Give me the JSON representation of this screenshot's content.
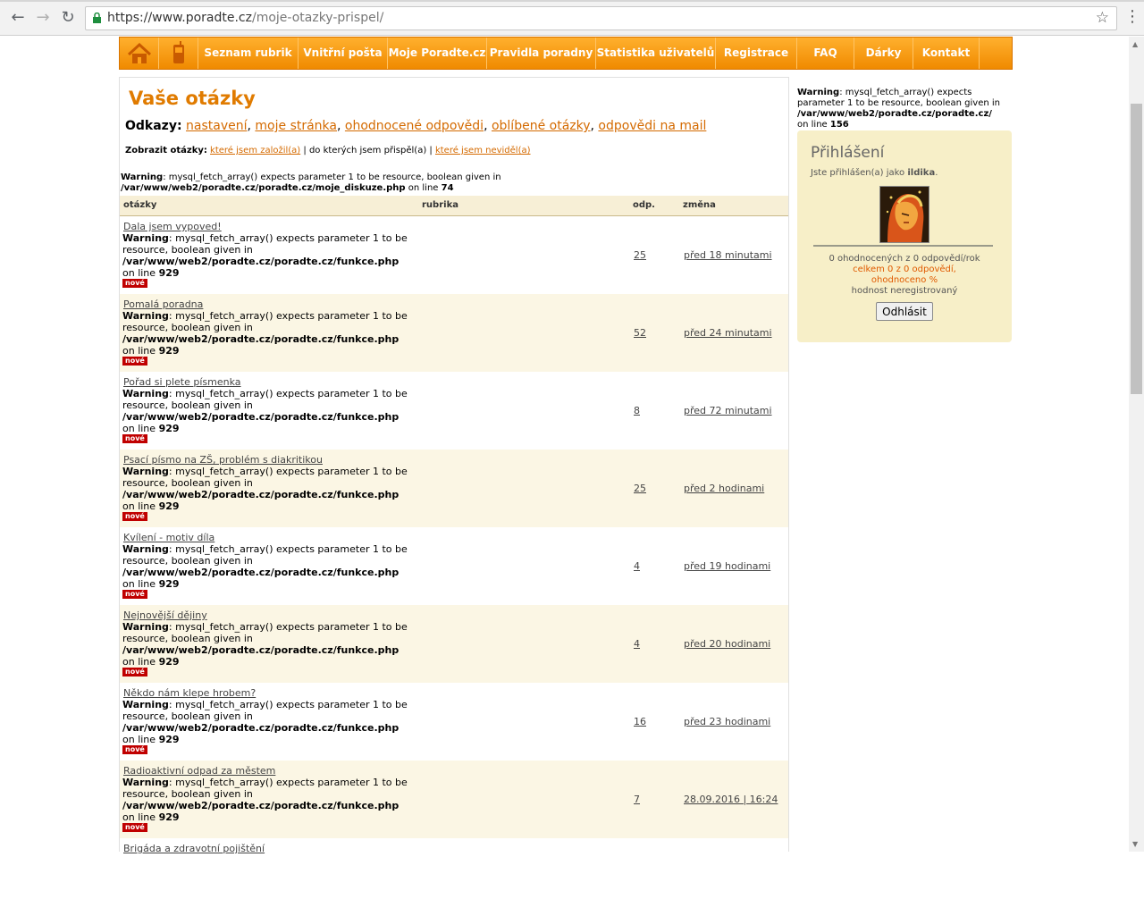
{
  "browser": {
    "url_base": "https://www.poradte.cz",
    "url_path": "/moje-otazky-prispel/"
  },
  "nav": {
    "items": [
      "Seznam rubrik",
      "Vnitřní pošta",
      "Moje Poradte.cz",
      "Pravidla poradny",
      "Statistika uživatelů",
      "Registrace",
      "FAQ",
      "Dárky",
      "Kontakt"
    ]
  },
  "main": {
    "title": "Vaše otázky",
    "links_label": "Odkazy:",
    "links": [
      "nastavení",
      "moje stránka",
      "ohodnocené odpovědi",
      "oblíbené otázky",
      "odpovědi na mail"
    ],
    "filter_label": "Zobrazit otázky:",
    "filter_created": "které jsem založil(a)",
    "filter_current": "do kterých jsem přispěl(a)",
    "filter_unseen": "které jsem neviděl(a)",
    "warning_label": "Warning",
    "warning_text": ": mysql_fetch_array() expects parameter 1 to be resource, boolean given in",
    "warning_path": "/var/www/web2/poradte.cz/poradte.cz/moje_diskuze.php",
    "warning_line_text": "on line",
    "warning_line": "74",
    "table_headers": [
      "otázky",
      "rubrika",
      "odp.",
      "změna"
    ],
    "row_warning_text": ": mysql_fetch_array() expects parameter 1 to be resource, boolean given in",
    "row_warning_path": "/var/www/web2/poradte.cz/poradte.cz/funkce.php",
    "row_warning_line": "929",
    "badge": "nové",
    "rows": [
      {
        "question": "Dala jsem vypoved!",
        "count": "25",
        "change": "před 18 minutami"
      },
      {
        "question": "Pomalá poradna",
        "count": "52",
        "change": "před 24 minutami"
      },
      {
        "question": "Pořad si plete písmenka",
        "count": "8",
        "change": "před 72 minutami"
      },
      {
        "question": "Psací písmo na ZŠ, problém s diakritikou",
        "count": "25",
        "change": "před 2 hodinami"
      },
      {
        "question": "Kvílení - motiv díla",
        "count": "4",
        "change": "před 19 hodinami"
      },
      {
        "question": "Nejnovější dějiny",
        "count": "4",
        "change": "před 20 hodinami"
      },
      {
        "question": "Někdo nám klepe hrobem?",
        "count": "16",
        "change": "před 23 hodinami"
      },
      {
        "question": "Radioaktivní odpad za městem",
        "count": "7",
        "change": "28.09.2016 | 16:24"
      },
      {
        "question": "Brigáda a zdravotní pojištění",
        "count": "",
        "change": ""
      }
    ]
  },
  "sidebar": {
    "warning_path": "/var/www/web2/poradte.cz/poradte.cz/",
    "warning_line": "156",
    "login_title": "Přihlášení",
    "logged_as": "Jste přihlášen(a) jako",
    "username": "ildika",
    "stat1": "0 ohodnocených z 0 odpovědí/rok",
    "stat2": "celkem 0 z 0 odpovědí,",
    "stat3": "ohodnoceno %",
    "stat4": "hodnost neregistrovaný",
    "logout_label": "Odhlásit"
  },
  "colors": {
    "accent": "#e07b00",
    "link": "#d46a00",
    "badge": "#c00000",
    "row_alt": "#fbf6e4"
  }
}
